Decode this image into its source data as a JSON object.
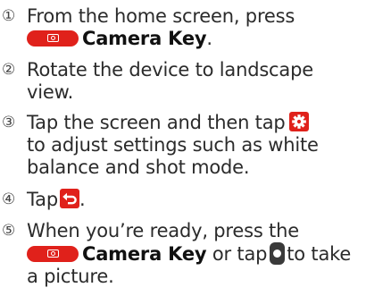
{
  "colors": {
    "camera_key": "#e0211b",
    "icon_bg": "#e0211b",
    "shutter_bg": "#3a3a3a"
  },
  "icons": {
    "camera_key": "camera-key-icon",
    "settings": "gear-icon",
    "back": "back-arrow-icon",
    "shutter": "shutter-icon"
  },
  "steps": [
    {
      "number": "①",
      "lines": [
        "From the home screen, press"
      ],
      "key_label": "Camera Key",
      "key_suffix": "."
    },
    {
      "number": "②",
      "lines": [
        "Rotate the device to landscape",
        "view."
      ]
    },
    {
      "number": "③",
      "line1": "Tap the screen and then tap",
      "line2": "to adjust settings such as white",
      "line3": "balance and shot mode."
    },
    {
      "number": "④",
      "before": "Tap",
      "after": "."
    },
    {
      "number": "⑤",
      "line1": "When you’re ready, press the",
      "key_label": "Camera Key",
      "middle": " or tap",
      "end": "to take",
      "line3": "a picture."
    }
  ]
}
